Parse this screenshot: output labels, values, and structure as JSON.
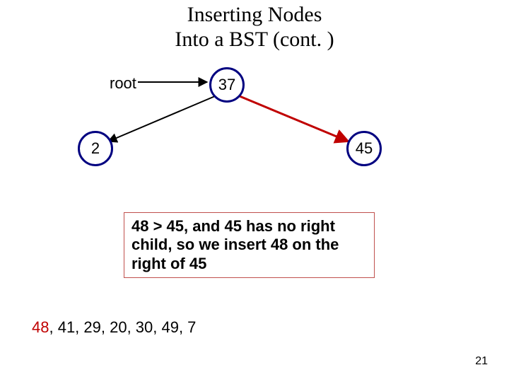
{
  "title_line1": "Inserting Nodes",
  "title_line2": "Into a BST (cont. )",
  "root_label": "root",
  "nodes": {
    "root": "37",
    "left": "2",
    "right": "45"
  },
  "explain": "48 > 45, and 45 has no right child, so we insert 48 on the right of 45",
  "sequence": {
    "highlighted": "48",
    "rest": ", 41, 29, 20, 30, 49, 7"
  },
  "page_number": "21"
}
